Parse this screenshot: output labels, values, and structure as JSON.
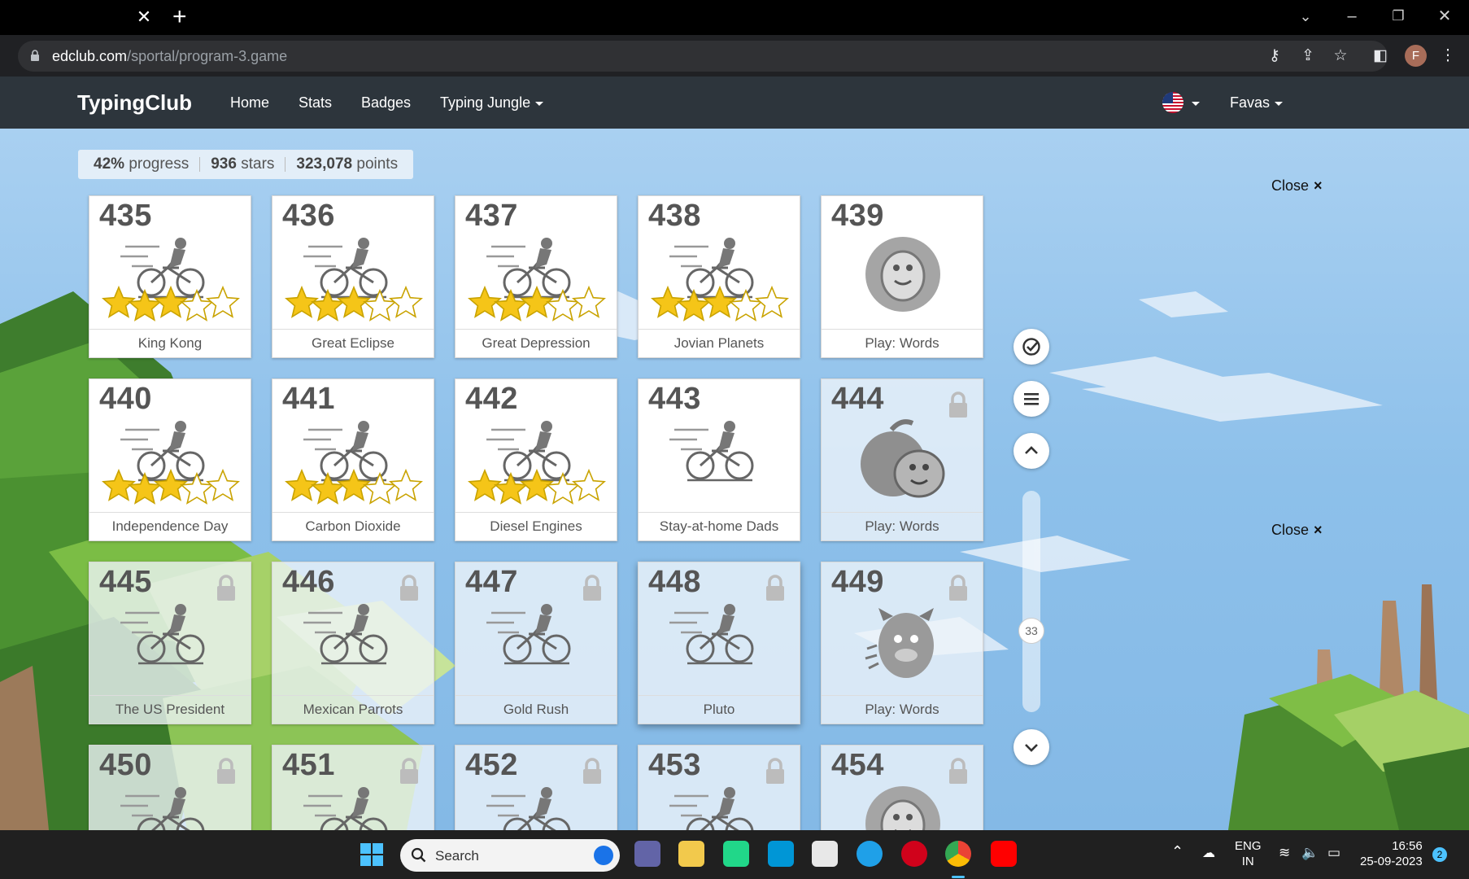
{
  "browser": {
    "url_domain": "edclub.com",
    "url_path": "/sportal/program-3.game",
    "profile_initial": "F"
  },
  "nav": {
    "brand": "TypingClub",
    "links": [
      "Home",
      "Stats",
      "Badges",
      "Typing Jungle"
    ],
    "user": "Favas"
  },
  "stats": {
    "progress_value": "42%",
    "progress_label": "progress",
    "stars_value": "936",
    "stars_label": "stars",
    "points_value": "323,078",
    "points_label": "points"
  },
  "close_label": "Close",
  "close_glyph": "×",
  "lessons": [
    {
      "num": "435",
      "title": "King Kong",
      "kind": "bike",
      "stars": 3,
      "locked": false
    },
    {
      "num": "436",
      "title": "Great Eclipse",
      "kind": "bike",
      "stars": 3,
      "locked": false
    },
    {
      "num": "437",
      "title": "Great Depression",
      "kind": "bike",
      "stars": 3,
      "locked": false
    },
    {
      "num": "438",
      "title": "Jovian Planets",
      "kind": "bike",
      "stars": 3,
      "locked": false
    },
    {
      "num": "439",
      "title": "Play: Words",
      "kind": "game-ball",
      "stars": 0,
      "locked": false
    },
    {
      "num": "440",
      "title": "Independence Day",
      "kind": "bike",
      "stars": 3,
      "locked": false
    },
    {
      "num": "441",
      "title": "Carbon Dioxide",
      "kind": "bike",
      "stars": 3,
      "locked": false
    },
    {
      "num": "442",
      "title": "Diesel Engines",
      "kind": "bike",
      "stars": 3,
      "locked": false
    },
    {
      "num": "443",
      "title": "Stay-at-home Dads",
      "kind": "bike",
      "stars": 0,
      "locked": false
    },
    {
      "num": "444",
      "title": "Play: Words",
      "kind": "game-apple",
      "stars": 0,
      "locked": true
    },
    {
      "num": "445",
      "title": "The US President",
      "kind": "bike",
      "stars": 0,
      "locked": true
    },
    {
      "num": "446",
      "title": "Mexican Parrots",
      "kind": "bike",
      "stars": 0,
      "locked": true
    },
    {
      "num": "447",
      "title": "Gold Rush",
      "kind": "bike",
      "stars": 0,
      "locked": true
    },
    {
      "num": "448",
      "title": "Pluto",
      "kind": "bike",
      "stars": 0,
      "locked": true
    },
    {
      "num": "449",
      "title": "Play: Words",
      "kind": "game-monster",
      "stars": 0,
      "locked": true
    },
    {
      "num": "450",
      "title": "",
      "kind": "bike",
      "stars": 0,
      "locked": true
    },
    {
      "num": "451",
      "title": "",
      "kind": "bike",
      "stars": 0,
      "locked": true
    },
    {
      "num": "452",
      "title": "",
      "kind": "bike",
      "stars": 0,
      "locked": true
    },
    {
      "num": "453",
      "title": "",
      "kind": "bike",
      "stars": 0,
      "locked": true
    },
    {
      "num": "454",
      "title": "",
      "kind": "game-ball",
      "stars": 0,
      "locked": true
    }
  ],
  "scroll_page": "33",
  "taskbar": {
    "search_label": "Search",
    "lang_top": "ENG",
    "lang_bottom": "IN",
    "time": "16:56",
    "date": "25-09-2023",
    "notification_count": "2"
  },
  "colors": {
    "nav_bg": "#2d353c",
    "star": "#f5c518",
    "card_text": "#555555"
  }
}
